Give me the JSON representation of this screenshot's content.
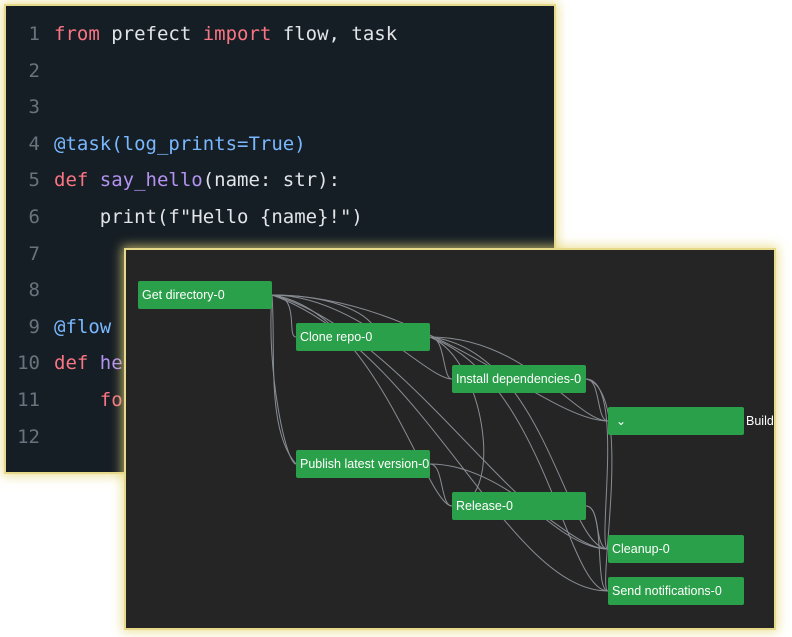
{
  "code": {
    "lines": [
      {
        "num": "1",
        "tokens": [
          [
            "kw",
            "from"
          ],
          [
            "plain",
            " prefect "
          ],
          [
            "kw",
            "import"
          ],
          [
            "plain",
            " flow, task"
          ]
        ]
      },
      {
        "num": "2",
        "tokens": []
      },
      {
        "num": "3",
        "tokens": []
      },
      {
        "num": "4",
        "tokens": [
          [
            "dec",
            "@task(log_prints=True)"
          ]
        ]
      },
      {
        "num": "5",
        "tokens": [
          [
            "kw",
            "def"
          ],
          [
            "plain",
            " "
          ],
          [
            "fn",
            "say_hello"
          ],
          [
            "plain",
            "(name: str):"
          ]
        ]
      },
      {
        "num": "6",
        "tokens": [
          [
            "plain",
            "    print(f\"Hello {name}!\")"
          ]
        ]
      },
      {
        "num": "7",
        "tokens": []
      },
      {
        "num": "8",
        "tokens": []
      },
      {
        "num": "9",
        "tokens": [
          [
            "dec",
            "@flow"
          ]
        ]
      },
      {
        "num": "10",
        "tokens": [
          [
            "kw",
            "def"
          ],
          [
            "plain",
            " "
          ],
          [
            "fn",
            "he"
          ]
        ]
      },
      {
        "num": "11",
        "tokens": [
          [
            "plain",
            "    "
          ],
          [
            "kw",
            "fo"
          ]
        ]
      },
      {
        "num": "12",
        "tokens": []
      }
    ]
  },
  "graph": {
    "nodes": {
      "get_directory": "Get directory-0",
      "clone_repo": "Clone repo-0",
      "install_dependencies": "Install dependencies-0",
      "build_chevron": "⌄",
      "build_label": "Build",
      "publish_latest_version": "Publish latest version-0",
      "release": "Release-0",
      "cleanup": "Cleanup-0",
      "send_notifications": "Send notifications-0"
    }
  },
  "colors": {
    "code_bg": "#161e25",
    "graph_bg": "#252526",
    "node_green": "#2ba04a",
    "highlight_border": "#e6d98a",
    "keyword": "#f97583",
    "function": "#b392f0",
    "decorator": "#79b8ff"
  }
}
